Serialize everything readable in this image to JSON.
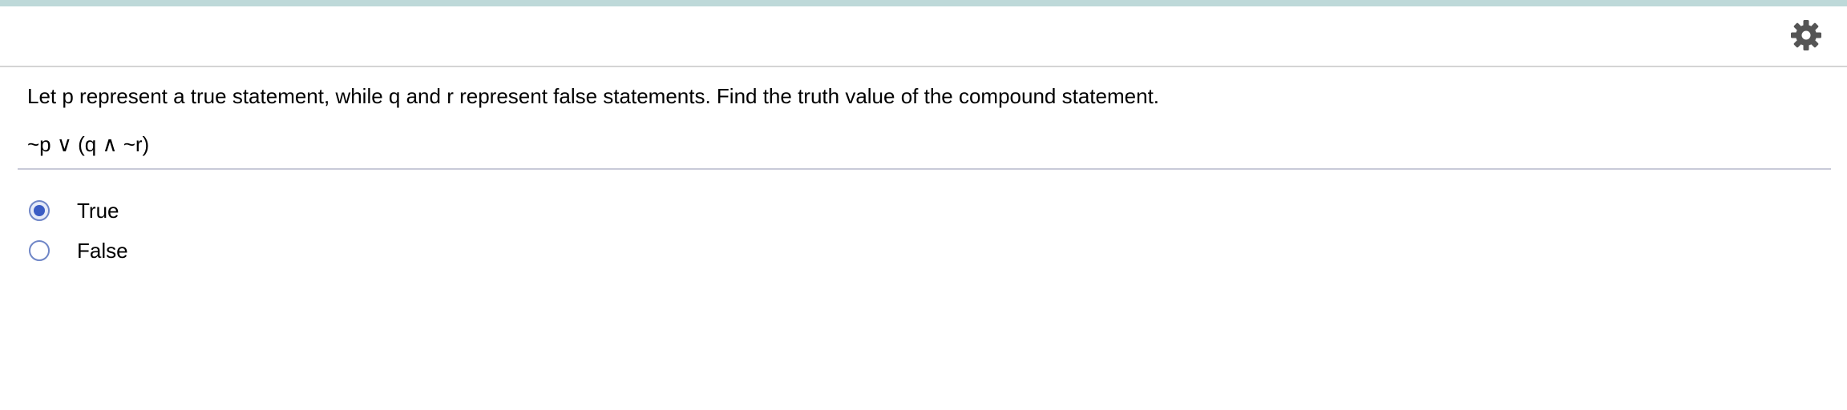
{
  "header": {
    "settings_icon": "gear-icon",
    "accent_color": "#bed9d9"
  },
  "question": {
    "prompt": "Let p represent a true statement, while q and r represent false statements. Find the truth value of the compound statement.",
    "expression": "~p ∨ (q ∧ ~r)"
  },
  "answer_options": [
    {
      "label": "True",
      "selected": true
    },
    {
      "label": "False",
      "selected": false
    }
  ],
  "colors": {
    "radio_border": "#6f86c7",
    "radio_selected": "#3a5cc4"
  }
}
